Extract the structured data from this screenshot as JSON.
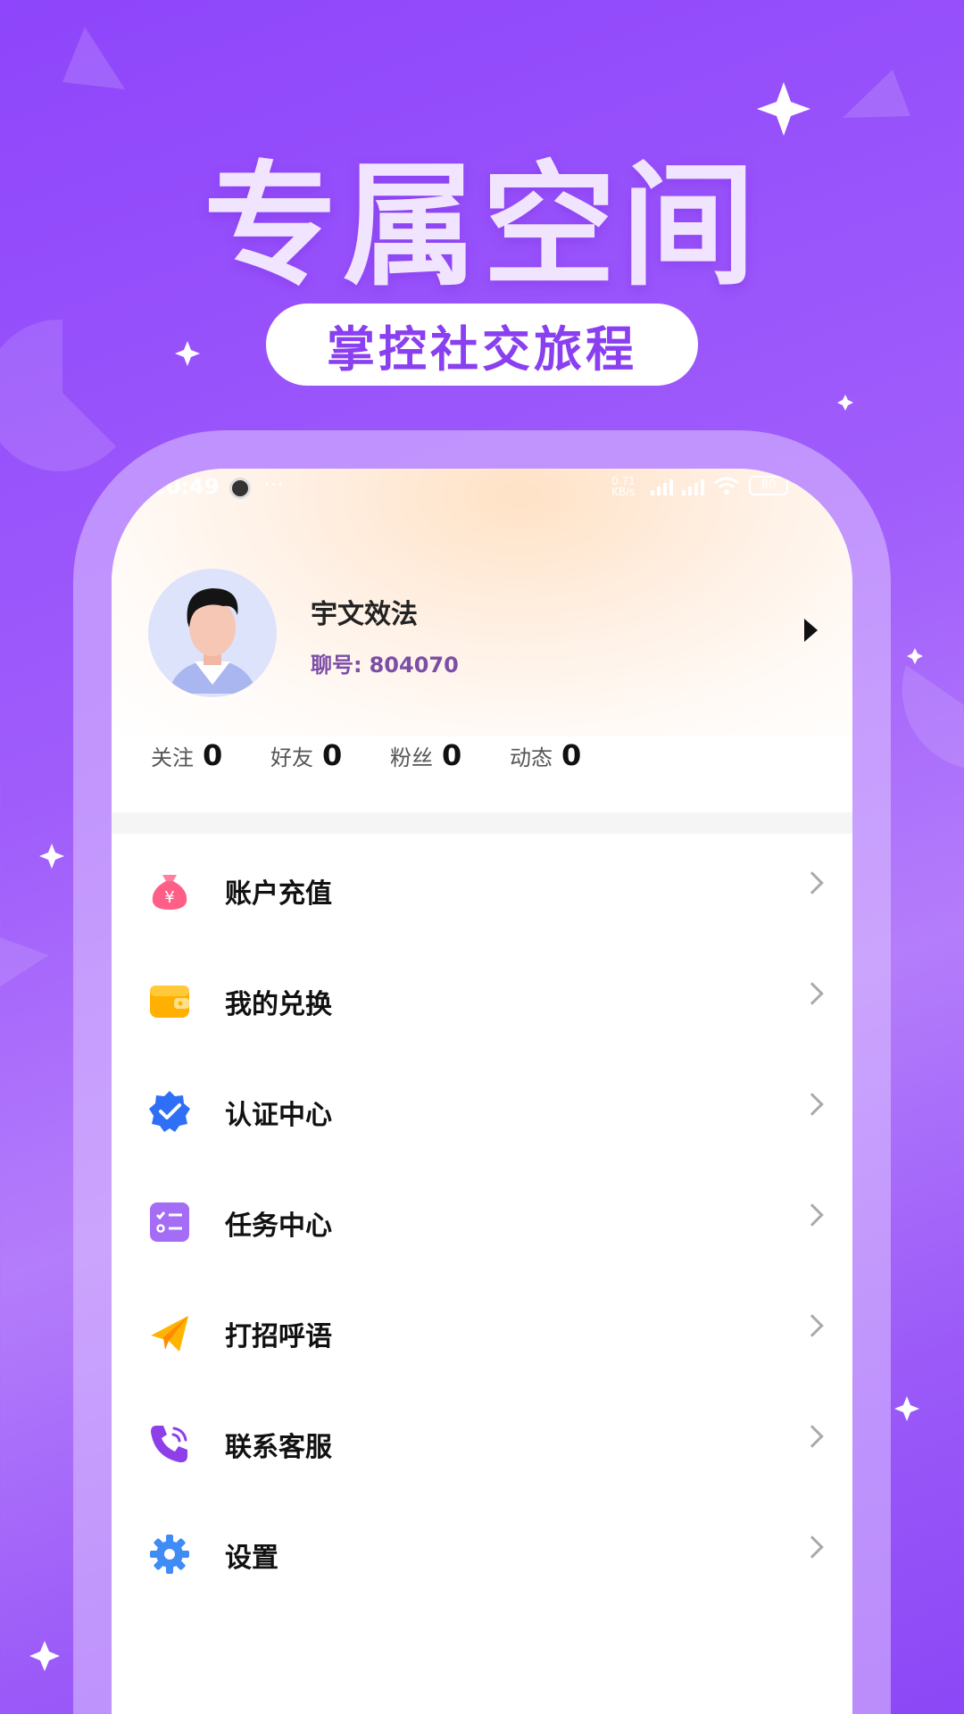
{
  "promo": {
    "headline": "专属空间",
    "tagline": "掌控社交旅程"
  },
  "status_bar": {
    "time": "10:49",
    "more": "···",
    "net_speed_value": "0.71",
    "net_speed_unit": "KB/s",
    "battery": "80"
  },
  "profile": {
    "name": "宇文效法",
    "id_label": "聊号:",
    "id_value": "804070"
  },
  "stats": [
    {
      "label": "关注",
      "value": "0"
    },
    {
      "label": "好友",
      "value": "0"
    },
    {
      "label": "粉丝",
      "value": "0"
    },
    {
      "label": "动态",
      "value": "0"
    }
  ],
  "menu": [
    {
      "label": "账户充值",
      "icon": "money-bag-icon"
    },
    {
      "label": "我的兑换",
      "icon": "wallet-icon"
    },
    {
      "label": "认证中心",
      "icon": "verified-badge-icon"
    },
    {
      "label": "任务中心",
      "icon": "task-list-icon"
    },
    {
      "label": "打招呼语",
      "icon": "paper-plane-icon"
    },
    {
      "label": "联系客服",
      "icon": "phone-icon"
    },
    {
      "label": "设置",
      "icon": "gear-icon"
    }
  ],
  "colors": {
    "background": "#9b5af8",
    "accent": "#8a3ff0",
    "id_text": "#7c4ea6"
  }
}
